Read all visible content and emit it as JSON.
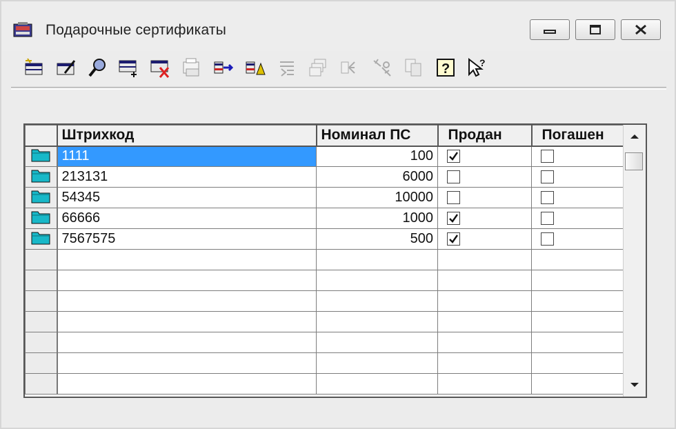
{
  "window": {
    "title": "Подарочные сертификаты"
  },
  "toolbar": {
    "icons": [
      "add-record-icon",
      "edit-record-icon",
      "find-icon",
      "insert-record-icon",
      "delete-record-icon",
      "print-icon",
      "move-icon",
      "merge-icon",
      "filter-icon",
      "copy-icon",
      "group-icon",
      "tools-icon",
      "duplicate-icon",
      "help-icon",
      "context-help-icon"
    ]
  },
  "grid": {
    "columns": [
      "Штрихкод",
      "Номинал ПС",
      "Продан",
      "Погашен"
    ],
    "rows": [
      {
        "barcode": "1111",
        "nominal": "100",
        "sold": true,
        "redeemed": false
      },
      {
        "barcode": "213131",
        "nominal": "6000",
        "sold": false,
        "redeemed": false
      },
      {
        "barcode": "54345",
        "nominal": "10000",
        "sold": false,
        "redeemed": false
      },
      {
        "barcode": "66666",
        "nominal": "1000",
        "sold": true,
        "redeemed": false
      },
      {
        "barcode": "7567575",
        "nominal": "500",
        "sold": true,
        "redeemed": false
      }
    ],
    "empty_rows": 7,
    "selection_color": "#3399ff"
  }
}
